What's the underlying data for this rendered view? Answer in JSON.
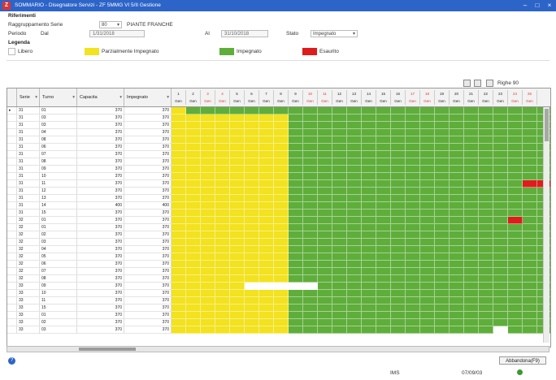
{
  "window": {
    "title": "SOMMARIO - Disegnatore Servizi - ZF 5MMG VI 5/II Gestione",
    "app_icon_letter": "Z"
  },
  "filters": {
    "section_label": "Riferimenti",
    "grouping_label": "Raggruppamento Serie",
    "grouping_value": "80",
    "grouping_text": "PIANTE FRANCHE",
    "period_label": "Periodo",
    "from_label": "Dal",
    "from_value": "1/31/2018",
    "to_label": "Al",
    "to_value": "31/10/2018",
    "state_label": "Stato",
    "state_value": "Impegnato"
  },
  "legend": {
    "title": "Legenda",
    "items": [
      {
        "label": "Libero",
        "color": "#ffffff"
      },
      {
        "label": "Parzialmente Impegnato",
        "color": "#f2e21f"
      },
      {
        "label": "Impegnato",
        "color": "#5fae3b"
      },
      {
        "label": "Esaurito",
        "color": "#dd1c1c"
      }
    ]
  },
  "toolbar": {
    "rows_label": "Righe 90"
  },
  "table": {
    "columns": [
      "Serie",
      "Turno",
      "Capacita",
      "Impegnato"
    ],
    "day_headers": [
      {
        "n": "1",
        "d": "Gen",
        "weekend": false
      },
      {
        "n": "2",
        "d": "Gen",
        "weekend": false
      },
      {
        "n": "3",
        "d": "Gen",
        "weekend": true
      },
      {
        "n": "4",
        "d": "Gen",
        "weekend": true
      },
      {
        "n": "5",
        "d": "Gen",
        "weekend": false
      },
      {
        "n": "6",
        "d": "Gen",
        "weekend": false
      },
      {
        "n": "7",
        "d": "Gen",
        "weekend": false
      },
      {
        "n": "8",
        "d": "Gen",
        "weekend": false
      },
      {
        "n": "9",
        "d": "Gen",
        "weekend": false
      },
      {
        "n": "10",
        "d": "Gen",
        "weekend": true
      },
      {
        "n": "11",
        "d": "Gen",
        "weekend": true
      },
      {
        "n": "12",
        "d": "Gen",
        "weekend": false
      },
      {
        "n": "13",
        "d": "Gen",
        "weekend": false
      },
      {
        "n": "14",
        "d": "Gen",
        "weekend": false
      },
      {
        "n": "15",
        "d": "Gen",
        "weekend": false
      },
      {
        "n": "16",
        "d": "Gen",
        "weekend": false
      },
      {
        "n": "17",
        "d": "Gen",
        "weekend": true
      },
      {
        "n": "18",
        "d": "Gen",
        "weekend": true
      },
      {
        "n": "19",
        "d": "Gen",
        "weekend": false
      },
      {
        "n": "20",
        "d": "Gen",
        "weekend": false
      },
      {
        "n": "21",
        "d": "Gen",
        "weekend": false
      },
      {
        "n": "22",
        "d": "Gen",
        "weekend": false
      },
      {
        "n": "23",
        "d": "Gen",
        "weekend": false
      },
      {
        "n": "24",
        "d": "Gen",
        "weekend": true
      },
      {
        "n": "25",
        "d": "Gen",
        "weekend": true
      }
    ],
    "rows": [
      [
        "31",
        "01",
        "370",
        "370"
      ],
      [
        "31",
        "03",
        "370",
        "370"
      ],
      [
        "31",
        "03",
        "370",
        "370"
      ],
      [
        "31",
        "04",
        "370",
        "370"
      ],
      [
        "31",
        "08",
        "370",
        "370"
      ],
      [
        "31",
        "06",
        "370",
        "370"
      ],
      [
        "31",
        "07",
        "370",
        "370"
      ],
      [
        "31",
        "08",
        "370",
        "370"
      ],
      [
        "31",
        "09",
        "370",
        "370"
      ],
      [
        "31",
        "10",
        "370",
        "370"
      ],
      [
        "31",
        "11",
        "370",
        "370"
      ],
      [
        "31",
        "12",
        "370",
        "370"
      ],
      [
        "31",
        "13",
        "370",
        "370"
      ],
      [
        "31",
        "14",
        "400",
        "400"
      ],
      [
        "31",
        "15",
        "370",
        "370"
      ],
      [
        "32",
        "01",
        "370",
        "370"
      ],
      [
        "32",
        "01",
        "370",
        "370"
      ],
      [
        "32",
        "02",
        "370",
        "370"
      ],
      [
        "32",
        "03",
        "370",
        "370"
      ],
      [
        "32",
        "04",
        "370",
        "370"
      ],
      [
        "32",
        "05",
        "370",
        "370"
      ],
      [
        "32",
        "06",
        "370",
        "370"
      ],
      [
        "32",
        "07",
        "370",
        "370"
      ],
      [
        "32",
        "08",
        "370",
        "370"
      ],
      [
        "33",
        "09",
        "370",
        "370"
      ],
      [
        "33",
        "10",
        "370",
        "370"
      ],
      [
        "33",
        "11",
        "370",
        "370"
      ],
      [
        "33",
        "15",
        "370",
        "370"
      ],
      [
        "33",
        "01",
        "370",
        "370"
      ],
      [
        "33",
        "02",
        "370",
        "370"
      ],
      [
        "33",
        "03",
        "370",
        "370"
      ]
    ],
    "cell_status": [
      "YGGGGGGGGGGGGGGGGGGGGGGGGG",
      "YYYYYYYYGGGGGGGGGGGGGGGGGG",
      "YYYYYYYYGGGGGGGGGGGGGGGGGG",
      "YYYYYYYYGGGGGGGGGGGGGGGGGG",
      "YYYYYYYYGGGGGGGGGGGGGGGGGG",
      "YYYYYYYYGGGGGGGGGGGGGGGGGG",
      "YYYYYYYYGGGGGGGGGGGGGGGGGG",
      "YYYYYYYYGGGGGGGGGGGGGGGGGG",
      "YYYYYYYYGGGGGGGGGGGGGGGGGG",
      "YYYYYYYYGGGGGGGGGGGGGGGGGG",
      "YYYYYYYYGGGGGGGGGGGGGGGGRR",
      "YYYYYYYYGGGGGGGGGGGGGGGGGG",
      "YYYYYYYYGGGGGGGGGGGGGGGGGG",
      "YYYYYYYYGGGGGGGGGGGGGGGGGG",
      "YYYYYYYYGGGGGGGGGGGGGGGGGG",
      "YYYYYYYYGGGGGGGGGGGGGGGRGG",
      "YYYYYYYYGGGGGGGGGGGGGGGGGG",
      "YYYYYYYYGGGGGGGGGGGGGGGGGG",
      "YYYYYYYYGGGGGGGGGGGGGGGGGG",
      "YYYYYYYYGGGGGGGGGGGGGGGGGG",
      "YYYYYYYYGGGGGGGGGGGGGGGGGG",
      "YYYYYYYYGGGGGGGGGGGGGGGGGG",
      "YYYYYYYYGGGGGGGGGGGGGGGGGG",
      "YYYYYYYYGGGGGGGGGGGGGGGGGG",
      "YYYYYWWWWWGGGGGGGGGGGGGGGG",
      "YYYYYYYYGGGGGGGGGGGGGGGGGG",
      "YYYYYYYYGGGGGGGGGGGGGGGGGG",
      "YYYYYYYYGGGGGGGGGGGGGGGGGG",
      "YYYYYYYYGGGGGGGGGGGGGGGGGG",
      "YYYYYYYYGGGGGGGGGGGGGGGGGG",
      "YYYYYYYYGGGGGGGGGGGGGGWGGG"
    ]
  },
  "footer": {
    "close_label": "Abbandona(F9)",
    "status_left": "IMS",
    "status_date": "07/09/03"
  },
  "colors": {
    "titlebar": "#2d64c8",
    "yellow": "#f2e21f",
    "green": "#5fae3b",
    "red": "#dd1c1c",
    "free": "#ffffff",
    "weekend_text": "#d83a3a"
  }
}
